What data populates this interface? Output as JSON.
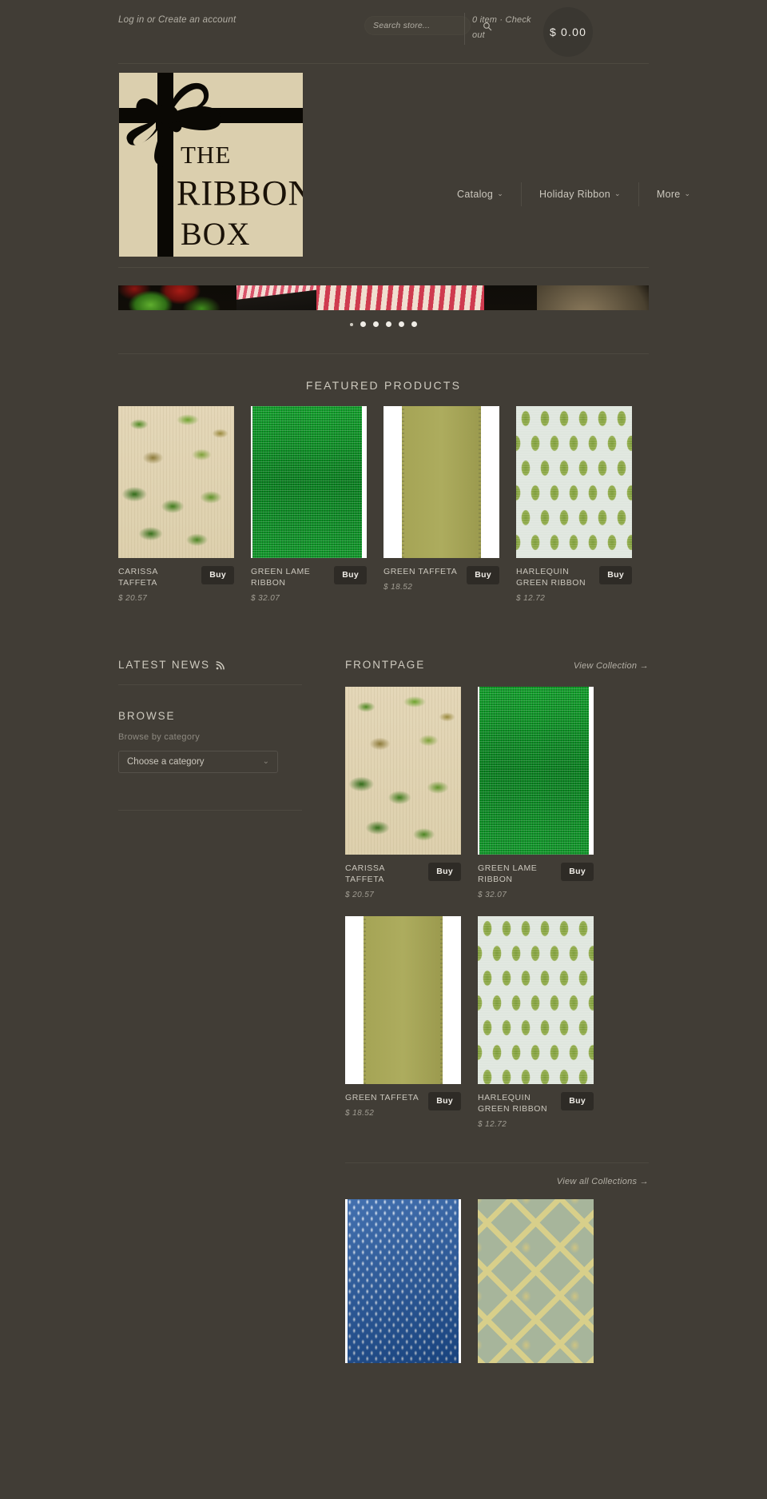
{
  "topbar": {
    "login_label": "Log in",
    "or_label": " or ",
    "create_account_label": "Create an account",
    "search_placeholder": "Search store...",
    "search_value": "",
    "search_icon": "search-icon",
    "cart_items": "0 item",
    "cart_sep": " · ",
    "cart_checkout": "Check out",
    "cart_total": "$ 0.00"
  },
  "logo": {
    "line1": "THE",
    "line2": "RIBBON",
    "line3": "BOX",
    "bg_color": "#dbcfae",
    "ink_color": "#0a0804"
  },
  "nav": {
    "items": [
      {
        "label": "Catalog",
        "caret": "⌄"
      },
      {
        "label": "Holiday Ribbon",
        "caret": "⌄"
      },
      {
        "label": "More",
        "caret": "⌄"
      }
    ]
  },
  "slideshow": {
    "dots": 6,
    "active_index": 0,
    "slides": [
      {
        "name": "slide-red-green-ribbons"
      },
      {
        "name": "slide-pink-striped-ribbon"
      },
      {
        "name": "slide-red-white-ribbon-spools"
      }
    ]
  },
  "featured": {
    "title": "FEATURED PRODUCTS",
    "buy_label": "Buy",
    "products": [
      {
        "name": "CARISSA TAFFETA",
        "price": "$ 20.57",
        "swatch": "sw-carissa"
      },
      {
        "name": "GREEN LAME RIBBON",
        "price": "$ 32.07",
        "swatch": "sw-lame"
      },
      {
        "name": "GREEN TAFFETA",
        "price": "$ 18.52",
        "swatch": "sw-taffeta"
      },
      {
        "name": "HARLEQUIN GREEN RIBBON",
        "price": "$ 12.72",
        "swatch": "sw-harlequin"
      }
    ]
  },
  "sidebar": {
    "news_title": "LATEST NEWS",
    "rss_icon": "rss-icon",
    "browse_title": "BROWSE",
    "browse_subtitle": "Browse by category",
    "category_selected": "Choose a category",
    "category_caret": "⌄"
  },
  "frontpage": {
    "title": "FRONTPAGE",
    "view_collection_label": "View Collection →",
    "buy_label": "Buy",
    "products": [
      {
        "name": "CARISSA TAFFETA",
        "price": "$ 20.57",
        "swatch": "sw-carissa"
      },
      {
        "name": "GREEN LAME RIBBON",
        "price": "$ 32.07",
        "swatch": "sw-lame"
      },
      {
        "name": "GREEN TAFFETA",
        "price": "$ 18.52",
        "swatch": "sw-taffeta"
      },
      {
        "name": "HARLEQUIN GREEN RIBBON",
        "price": "$ 12.72",
        "swatch": "sw-harlequin"
      }
    ]
  },
  "collections": {
    "view_all_label": "View all Collections →",
    "items": [
      {
        "swatch": "sw-blue"
      },
      {
        "swatch": "sw-gold"
      }
    ]
  },
  "theme": {
    "background": "#413d36",
    "text": "#cbc7bd",
    "muted": "#8e8a81",
    "rule": "#4d4940",
    "button_bg": "#2e2b26"
  }
}
